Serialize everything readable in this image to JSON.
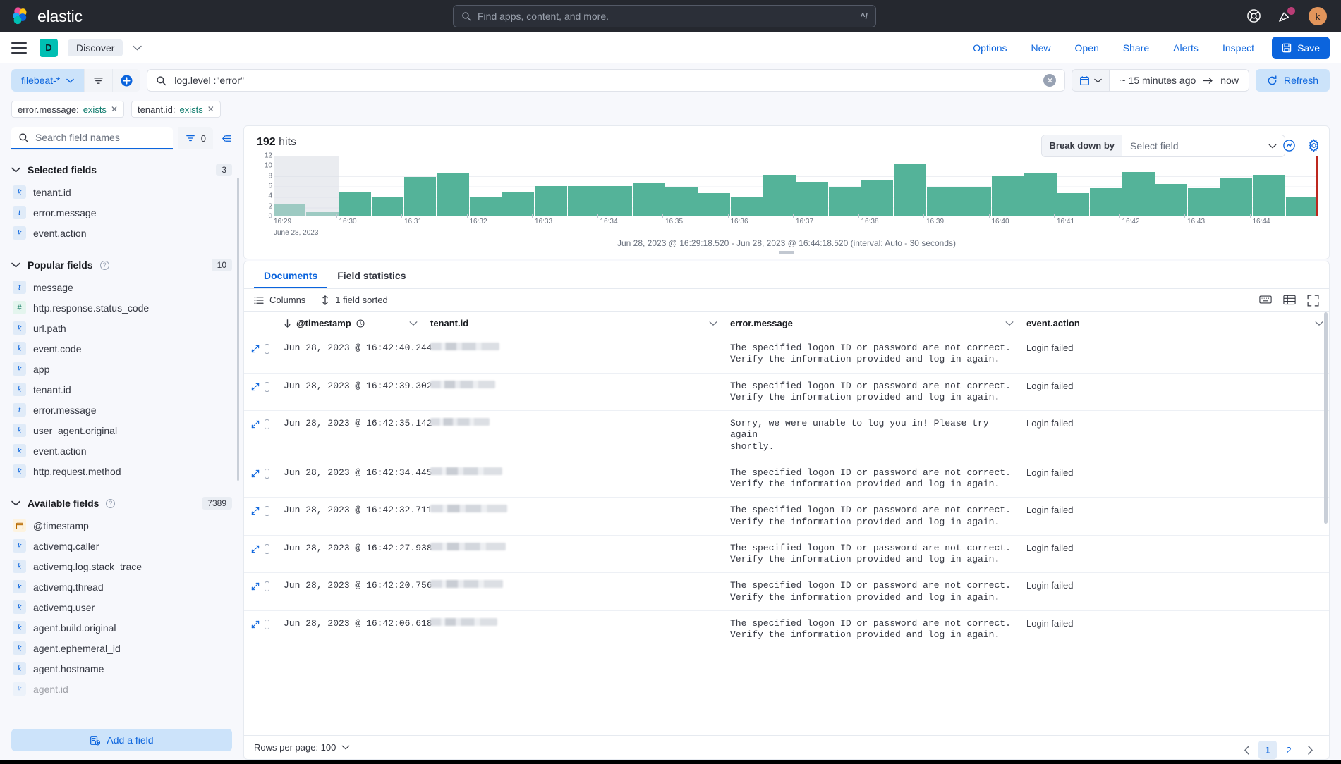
{
  "globalnav": {
    "brand": "elastic",
    "search_placeholder": "Find apps, content, and more.",
    "search_shortcut": "^/",
    "avatar_initial": "k"
  },
  "appbar": {
    "app_initial": "D",
    "breadcrumb": "Discover",
    "actions": [
      "Options",
      "New",
      "Open",
      "Share",
      "Alerts",
      "Inspect"
    ],
    "save_label": "Save"
  },
  "querybar": {
    "data_view": "filebeat-*",
    "query": "log.level :\"error\"",
    "time_from": "~ 15 minutes ago",
    "time_to": "now",
    "refresh_label": "Refresh",
    "filters": [
      {
        "field": "error.message:",
        "value": "exists"
      },
      {
        "field": "tenant.id:",
        "value": "exists"
      }
    ]
  },
  "sidebar": {
    "search_placeholder": "Search field names",
    "filter_count": "0",
    "sections": [
      {
        "title": "Selected fields",
        "count": "3",
        "has_help": false,
        "fields": [
          {
            "name": "tenant.id",
            "type": "k"
          },
          {
            "name": "error.message",
            "type": "t"
          },
          {
            "name": "event.action",
            "type": "k"
          }
        ]
      },
      {
        "title": "Popular fields",
        "count": "10",
        "has_help": true,
        "fields": [
          {
            "name": "message",
            "type": "t"
          },
          {
            "name": "http.response.status_code",
            "type": "#"
          },
          {
            "name": "url.path",
            "type": "k"
          },
          {
            "name": "event.code",
            "type": "k"
          },
          {
            "name": "app",
            "type": "k"
          },
          {
            "name": "tenant.id",
            "type": "k"
          },
          {
            "name": "error.message",
            "type": "t"
          },
          {
            "name": "user_agent.original",
            "type": "k"
          },
          {
            "name": "event.action",
            "type": "k"
          },
          {
            "name": "http.request.method",
            "type": "k"
          }
        ]
      },
      {
        "title": "Available fields",
        "count": "7389",
        "has_help": true,
        "fields": [
          {
            "name": "@timestamp",
            "type": "date"
          },
          {
            "name": "activemq.caller",
            "type": "k"
          },
          {
            "name": "activemq.log.stack_trace",
            "type": "k"
          },
          {
            "name": "activemq.thread",
            "type": "k"
          },
          {
            "name": "activemq.user",
            "type": "k"
          },
          {
            "name": "agent.build.original",
            "type": "k"
          },
          {
            "name": "agent.ephemeral_id",
            "type": "k"
          },
          {
            "name": "agent.hostname",
            "type": "k"
          },
          {
            "name": "agent.id",
            "type": "k"
          }
        ]
      }
    ],
    "add_field_label": "Add a field"
  },
  "histogram": {
    "hits_count": "192",
    "hits_label": "hits",
    "breakdown_label": "Break down by",
    "breakdown_value": "Select field",
    "range_caption": "Jun 28, 2023 @ 16:29:18.520 - Jun 28, 2023 @ 16:44:18.520 (interval: Auto - 30 seconds)"
  },
  "chart_data": {
    "type": "bar",
    "title": "192 hits",
    "xlabel": "",
    "ylabel": "",
    "ylim": [
      0,
      12
    ],
    "yticks": [
      0,
      2,
      4,
      6,
      8,
      10,
      12
    ],
    "grid": true,
    "legend": null,
    "xtick_labels": [
      "16:29",
      "16:30",
      "16:31",
      "16:32",
      "16:33",
      "16:34",
      "16:35",
      "16:36",
      "16:37",
      "16:38",
      "16:39",
      "16:40",
      "16:41",
      "16:42",
      "16:43",
      "16:44"
    ],
    "x_sublabel": "June 28, 2023",
    "interval": "30 seconds",
    "bar_color": "#54B399",
    "values": [
      2.5,
      0.8,
      4.7,
      3.8,
      7.8,
      8.7,
      3.8,
      4.7,
      6,
      6,
      6,
      6.7,
      5.8,
      4.6,
      3.8,
      8.3,
      6.8,
      5.8,
      7.3,
      10.3,
      5.8,
      5.8,
      8,
      8.7,
      4.6,
      5.6,
      8.8,
      6.4,
      5.6,
      7.5,
      8.2,
      3.7
    ],
    "first_bar_shaded": true,
    "end_marker": {
      "color": "#BD271E",
      "position": "16:44"
    }
  },
  "doctable": {
    "tabs": [
      {
        "label": "Documents",
        "active": true
      },
      {
        "label": "Field statistics",
        "active": false
      }
    ],
    "toolbar": {
      "columns_label": "Columns",
      "sort_label": "1 field sorted"
    },
    "columns": [
      "@timestamp",
      "tenant.id",
      "error.message",
      "event.action"
    ],
    "rows": [
      {
        "timestamp": "Jun 28, 2023 @ 16:42:40.244",
        "tenant_id": "",
        "error_message": "The specified logon ID or password are not correct.\nVerify the information provided and log in again.",
        "event_action": "Login failed"
      },
      {
        "timestamp": "Jun 28, 2023 @ 16:42:39.302",
        "tenant_id": "",
        "error_message": "The specified logon ID or password are not correct.\nVerify the information provided and log in again.",
        "event_action": "Login failed"
      },
      {
        "timestamp": "Jun 28, 2023 @ 16:42:35.142",
        "tenant_id": "",
        "error_message": "Sorry, we were unable to log you in! Please try again\nshortly.",
        "event_action": "Login failed"
      },
      {
        "timestamp": "Jun 28, 2023 @ 16:42:34.445",
        "tenant_id": "",
        "error_message": "The specified logon ID or password are not correct.\nVerify the information provided and log in again.",
        "event_action": "Login failed"
      },
      {
        "timestamp": "Jun 28, 2023 @ 16:42:32.711",
        "tenant_id": "",
        "error_message": "The specified logon ID or password are not correct.\nVerify the information provided and log in again.",
        "event_action": "Login failed"
      },
      {
        "timestamp": "Jun 28, 2023 @ 16:42:27.938",
        "tenant_id": "",
        "error_message": "The specified logon ID or password are not correct.\nVerify the information provided and log in again.",
        "event_action": "Login failed"
      },
      {
        "timestamp": "Jun 28, 2023 @ 16:42:20.756",
        "tenant_id": "",
        "error_message": "The specified logon ID or password are not correct.\nVerify the information provided and log in again.",
        "event_action": "Login failed"
      },
      {
        "timestamp": "Jun 28, 2023 @ 16:42:06.618",
        "tenant_id": "",
        "error_message": "The specified logon ID or password are not correct.\nVerify the information provided and log in again.",
        "event_action": "Login failed"
      }
    ],
    "footer": {
      "rows_per_page_label": "Rows per page: 100",
      "pages": [
        "1",
        "2"
      ],
      "active_page": "1"
    }
  },
  "colors": {
    "accent_blue": "#0B64DD",
    "bar_green": "#54B399",
    "teal": "#00BFB3",
    "header_dark": "#25282F",
    "avatar_orange": "#E2955B"
  }
}
